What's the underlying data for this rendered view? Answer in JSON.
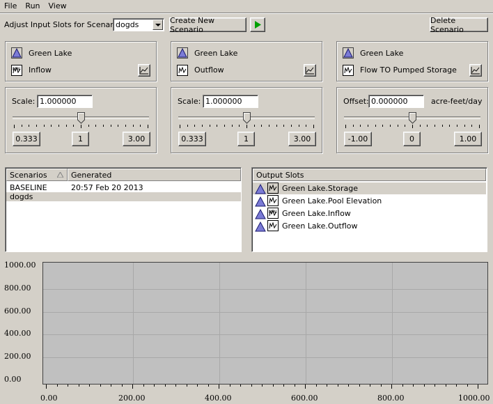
{
  "menu": {
    "items": [
      "File",
      "Run",
      "View"
    ]
  },
  "toolbar": {
    "scenario_label": "Adjust Input Slots for Scenario:",
    "scenario_value": "dogds",
    "create_label": "Create New Scenario",
    "delete_label": "Delete Scenario"
  },
  "slots": [
    {
      "object": "Green Lake",
      "slot": "Inflow"
    },
    {
      "object": "Green Lake",
      "slot": "Outflow"
    },
    {
      "object": "Green Lake",
      "slot": "Flow TO Pumped Storage"
    }
  ],
  "adjusters": [
    {
      "mode": "Scale:",
      "value": "1.000000",
      "unit": "",
      "min": "0.333",
      "mid": "1",
      "max": "3.00",
      "position": 0.5
    },
    {
      "mode": "Scale:",
      "value": "1.000000",
      "unit": "",
      "min": "0.333",
      "mid": "1",
      "max": "3.00",
      "position": 0.5
    },
    {
      "mode": "Offset:",
      "value": "0.000000",
      "unit": "acre-feet/day",
      "min": "-1.00",
      "mid": "0",
      "max": "1.00",
      "position": 0.5
    }
  ],
  "scenarios": {
    "col1": "Scenarios",
    "col2": "Generated",
    "rows": [
      {
        "name": "BASELINE",
        "generated": "20:57 Feb 20 2013"
      },
      {
        "name": "dogds",
        "generated": ""
      }
    ]
  },
  "output_slots": {
    "header": "Output Slots",
    "rows": [
      "Green Lake.Storage",
      "Green Lake.Pool Elevation",
      "Green Lake.Inflow",
      "Green Lake.Outflow"
    ]
  },
  "chart_data": {
    "type": "line",
    "series": [],
    "xlim": [
      0,
      1000
    ],
    "ylim": [
      0,
      1000
    ],
    "x_ticks": [
      "0.00",
      "200.00",
      "400.00",
      "600.00",
      "800.00",
      "1000.00"
    ],
    "y_ticks": [
      "1000.00",
      "800.00",
      "600.00",
      "400.00",
      "200.00",
      "0.00"
    ],
    "grid": true,
    "background": "#c0c0c0"
  }
}
